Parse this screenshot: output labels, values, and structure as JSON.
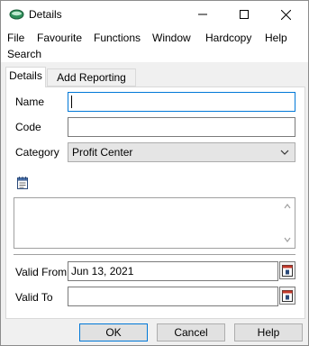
{
  "window": {
    "title": "Details"
  },
  "menu": [
    "File",
    "Favourite",
    "Functions",
    "Window",
    "Hardcopy",
    "Help",
    "Search"
  ],
  "tabs": [
    "Details",
    "Add Reporting Unit"
  ],
  "form": {
    "name_label": "Name",
    "name_value": "",
    "code_label": "Code",
    "code_value": "",
    "category_label": "Category",
    "category_value": "Profit Center",
    "valid_from_label": "Valid From",
    "valid_from_value": "Jun 13, 2021",
    "valid_to_label": "Valid To",
    "valid_to_value": ""
  },
  "buttons": {
    "ok": "OK",
    "cancel": "Cancel",
    "help": "Help"
  },
  "colors": {
    "accent": "#0078d7",
    "window_bg": "#f0f0f0"
  }
}
